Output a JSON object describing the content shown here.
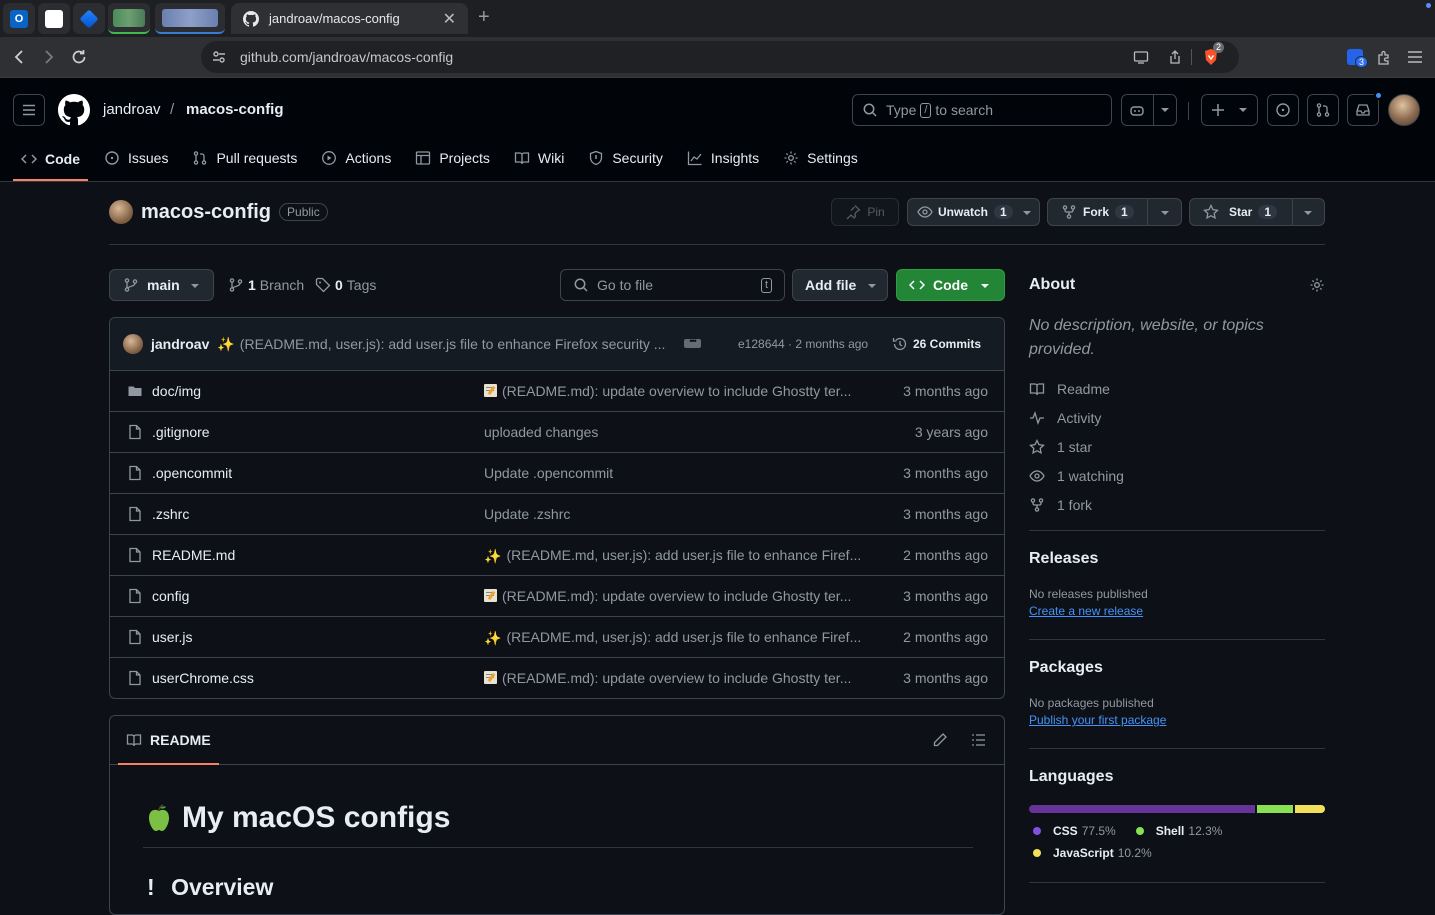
{
  "browser": {
    "tab_title": "jandroav/macos-config",
    "url": "github.com/jandroav/macos-config",
    "brave_badge": "2",
    "extension_badge": "3"
  },
  "header": {
    "owner": "jandroav",
    "separator": "/",
    "repo": "macos-config",
    "search_prefix": "Type",
    "search_key": "/",
    "search_suffix": "to search"
  },
  "repo_nav": {
    "tabs": [
      {
        "label": "Code"
      },
      {
        "label": "Issues"
      },
      {
        "label": "Pull requests"
      },
      {
        "label": "Actions"
      },
      {
        "label": "Projects"
      },
      {
        "label": "Wiki"
      },
      {
        "label": "Security"
      },
      {
        "label": "Insights"
      },
      {
        "label": "Settings"
      }
    ]
  },
  "repo": {
    "name": "macos-config",
    "visibility": "Public",
    "pin_label": "Pin",
    "watch_label": "Unwatch",
    "watch_count": "1",
    "fork_label": "Fork",
    "fork_count": "1",
    "star_label": "Star",
    "star_count": "1"
  },
  "branch": {
    "name": "main",
    "branches_count": "1",
    "branches_label": "Branch",
    "tags_count": "0",
    "tags_label": "Tags",
    "go_to_file": "Go to file",
    "go_to_file_key": "t",
    "add_file": "Add file",
    "code": "Code"
  },
  "latest_commit": {
    "author": "jandroav",
    "message": "(README.md, user.js): add user.js file to enhance Firefox security ...",
    "sha_and_time": "e128644 · 2 months ago",
    "commits_count": "26 Commits"
  },
  "files": [
    {
      "name": "doc/img",
      "type": "folder",
      "emoji": "memo",
      "message": "(README.md): update overview to include Ghostty ter...",
      "date": "3 months ago"
    },
    {
      "name": ".gitignore",
      "type": "file",
      "emoji": "",
      "message": "uploaded changes",
      "date": "3 years ago"
    },
    {
      "name": ".opencommit",
      "type": "file",
      "emoji": "",
      "message": "Update .opencommit",
      "date": "3 months ago"
    },
    {
      "name": ".zshrc",
      "type": "file",
      "emoji": "",
      "message": "Update .zshrc",
      "date": "3 months ago"
    },
    {
      "name": "README.md",
      "type": "file",
      "emoji": "sparkles",
      "message": "(README.md, user.js): add user.js file to enhance Firef...",
      "date": "2 months ago"
    },
    {
      "name": "config",
      "type": "file",
      "emoji": "memo",
      "message": "(README.md): update overview to include Ghostty ter...",
      "date": "3 months ago"
    },
    {
      "name": "user.js",
      "type": "file",
      "emoji": "sparkles",
      "message": "(README.md, user.js): add user.js file to enhance Firef...",
      "date": "2 months ago"
    },
    {
      "name": "userChrome.css",
      "type": "file",
      "emoji": "memo",
      "message": "(README.md): update overview to include Ghostty ter...",
      "date": "3 months ago"
    }
  ],
  "readme": {
    "tab_label": "README",
    "h1": "My macOS configs",
    "h2": "Overview"
  },
  "about": {
    "title": "About",
    "description": "No description, website, or topics provided.",
    "links": [
      "Readme",
      "Activity",
      "1 star",
      "1 watching",
      "1 fork"
    ]
  },
  "releases": {
    "title": "Releases",
    "none": "No releases published",
    "link": "Create a new release"
  },
  "packages": {
    "title": "Packages",
    "none": "No packages published",
    "link": "Publish your first package"
  },
  "languages": {
    "title": "Languages",
    "items": [
      {
        "name": "CSS",
        "percent": "77.5%",
        "share": 77.5,
        "color": "#663399"
      },
      {
        "name": "Shell",
        "percent": "12.3%",
        "share": 12.3,
        "color": "#89e051"
      },
      {
        "name": "JavaScript",
        "percent": "10.2%",
        "share": 10.2,
        "color": "#f1e05a"
      }
    ]
  },
  "colors": {
    "accent_underline": "#f78166",
    "primary_green": "#238636",
    "link_blue": "#4493f8"
  }
}
